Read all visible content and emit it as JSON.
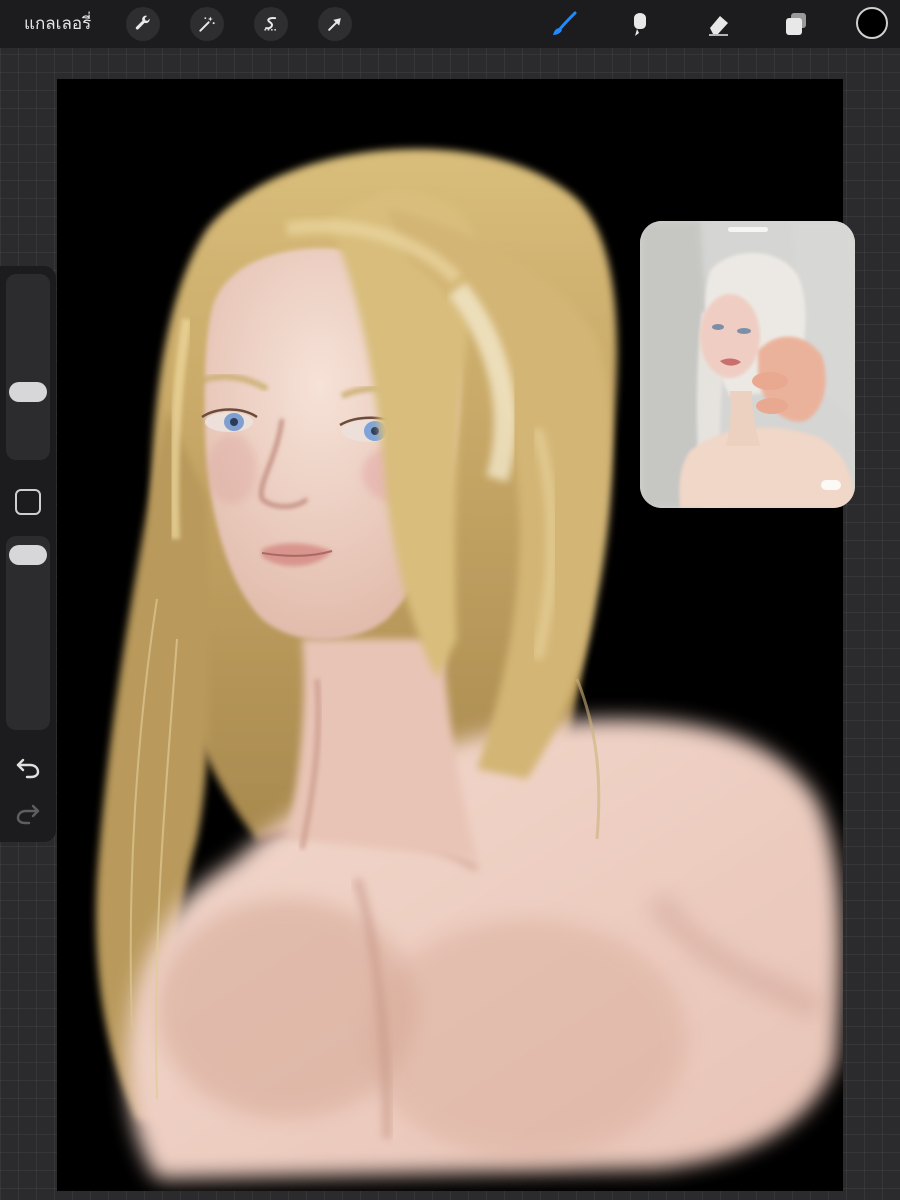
{
  "app": {
    "gallery_label": "แกลเลอรี่"
  },
  "toolbar": {
    "left_buttons": [
      "wrench-icon",
      "magic-wand-icon",
      "selection-s-icon",
      "arrow-icon"
    ],
    "right_tools": [
      "brush-icon",
      "smudge-icon",
      "eraser-icon",
      "layers-icon"
    ],
    "active_tool": "brush-icon",
    "accent_color": "#1f8bff",
    "current_color": "#000000"
  },
  "sidebar": {
    "brush_size_level": 0.35,
    "opacity_level": 0.95,
    "undo_icon": "undo-icon",
    "redo_icon": "redo-icon"
  },
  "canvas": {
    "background_color": "#000000"
  },
  "reference": {
    "background_color": "#cfcfcd"
  }
}
